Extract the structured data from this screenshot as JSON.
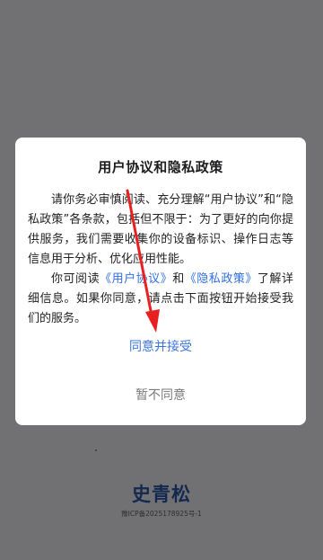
{
  "background": {
    "logo_text": "史青松",
    "icp_text": "豫ICP备2025178925号-1"
  },
  "dialog": {
    "title": "用户协议和隐私政策",
    "paragraph1": "请你务必审慎阅读、充分理解“用户协议”和“隐私政策”各条款，包括但不限于：为了更好的向你提供服务，我们需要收集你的设备标识、操作日志等信息用于分析、优化应用性能。",
    "p2_prefix": "你可阅读",
    "p2_link_user": "《用户协议》",
    "p2_and": "和",
    "p2_link_privacy": "《隐私政策》",
    "p2_suffix": "了解详细信息。如果你同意，请点击下面按钮开始接受我们的服务。",
    "agree_label": "同意并接受",
    "decline_label": "暂不同意"
  },
  "colors": {
    "overlay": "#717173",
    "link": "#2f6ee3",
    "agree": "#3c74e0",
    "decline": "#7b7b7f",
    "arrow": "#e8201f"
  },
  "annotation": {
    "type": "red-arrow",
    "target": "agree-button"
  }
}
